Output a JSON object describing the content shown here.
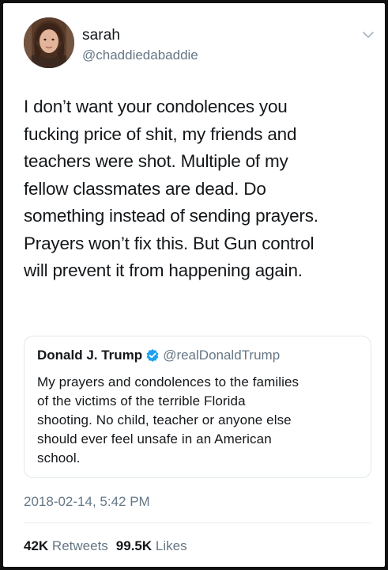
{
  "author": {
    "name": "sarah",
    "handle": "@chaddiedabaddie"
  },
  "tweet": {
    "lines": [
      "I don’t want your condolences you",
      "fucking price of shit, my friends and",
      "teachers were shot. Multiple of my",
      "fellow classmates are dead. Do",
      "something instead of sending prayers.",
      "Prayers won’t fix this. But Gun control",
      "will prevent it from happening again."
    ]
  },
  "quoted_tweet": {
    "name": "Donald J. Trump",
    "handle": "@realDonaldTrump",
    "lines": [
      "My prayers and condolences to the families",
      "of the victims of the terrible Florida",
      "shooting. No child, teacher or anyone else",
      "should ever feel unsafe in an American",
      "school."
    ]
  },
  "timestamp": "2018-02-14, 5:42 PM",
  "stats": {
    "retweets_count": "42K",
    "retweets_label": "Retweets",
    "likes_count": "99.5K",
    "likes_label": "Likes"
  },
  "icons": {
    "menu": "chevron-down-icon",
    "verified": "verified-badge-icon"
  },
  "colors": {
    "text": "#14171a",
    "secondary": "#657786",
    "verified": "#1da1f2",
    "border": "#e1e8ed"
  }
}
